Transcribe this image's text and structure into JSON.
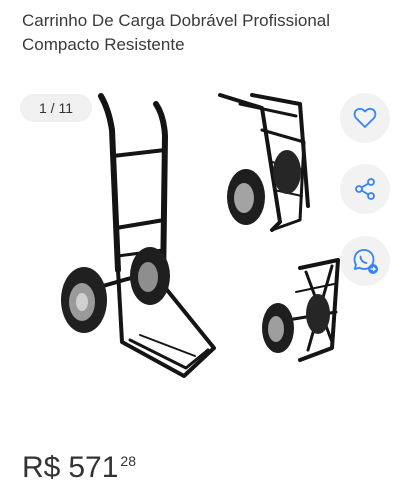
{
  "product": {
    "title": "Carrinho De Carga Dobrável Profissional Compacto Resistente"
  },
  "gallery": {
    "counter": "1 / 11"
  },
  "actions": {
    "favorite_icon": "heart-icon",
    "share_icon": "share-icon",
    "whatsapp_icon": "whatsapp-icon",
    "accent_color": "#3483fa"
  },
  "price": {
    "currency": "R$",
    "integer": "571",
    "cents": "28"
  }
}
